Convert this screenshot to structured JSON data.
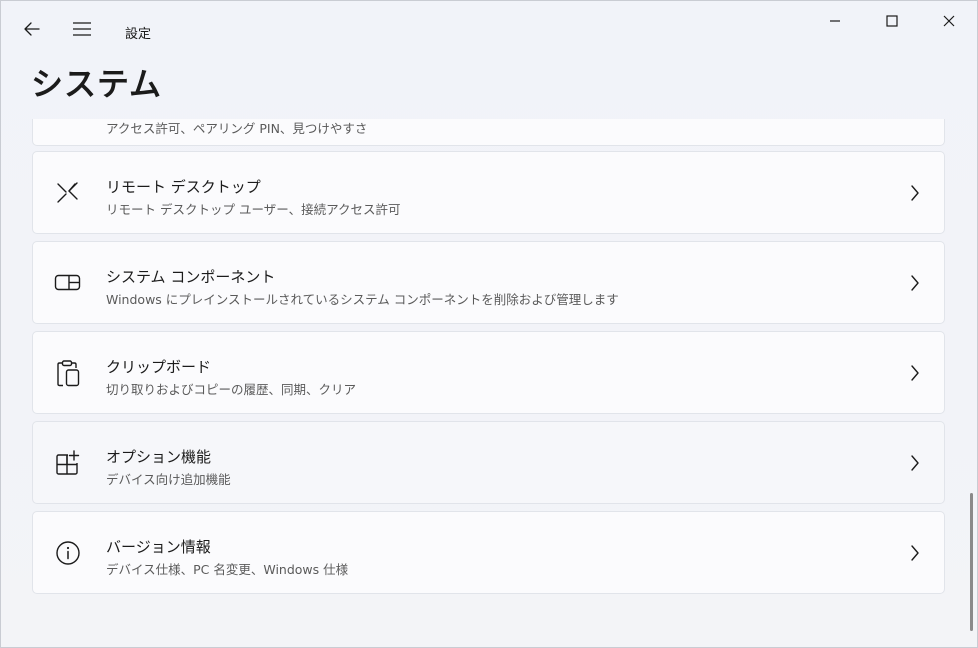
{
  "app": {
    "title": "設定",
    "page_title": "システム"
  },
  "titlebar": {
    "back_icon": "back-arrow-icon",
    "menu_icon": "hamburger-menu-icon",
    "minimize_icon": "minimize-icon",
    "maximize_icon": "maximize-icon",
    "close_icon": "close-icon"
  },
  "partial_item": {
    "subtitle": "アクセス許可、ペアリング PIN、見つけやすさ"
  },
  "items": [
    {
      "title": "リモート デスクトップ",
      "subtitle": "リモート デスクトップ ユーザー、接続アクセス許可",
      "icon": "remote-desktop-icon"
    },
    {
      "title": "システム コンポーネント",
      "subtitle": "Windows にプレインストールされているシステム コンポーネントを削除および管理します",
      "icon": "system-components-icon"
    },
    {
      "title": "クリップボード",
      "subtitle": "切り取りおよびコピーの履歴、同期、クリア",
      "icon": "clipboard-icon"
    },
    {
      "title": "オプション機能",
      "subtitle": "デバイス向け追加機能",
      "icon": "optional-features-icon"
    },
    {
      "title": "バージョン情報",
      "subtitle": "デバイス仕様、PC 名変更、Windows 仕様",
      "icon": "info-icon"
    }
  ],
  "colors": {
    "card_bg": "#fbfbfd",
    "card_border": "#e1e4ea",
    "text_primary": "#1b1b1b",
    "text_secondary": "#5a5a5a"
  }
}
